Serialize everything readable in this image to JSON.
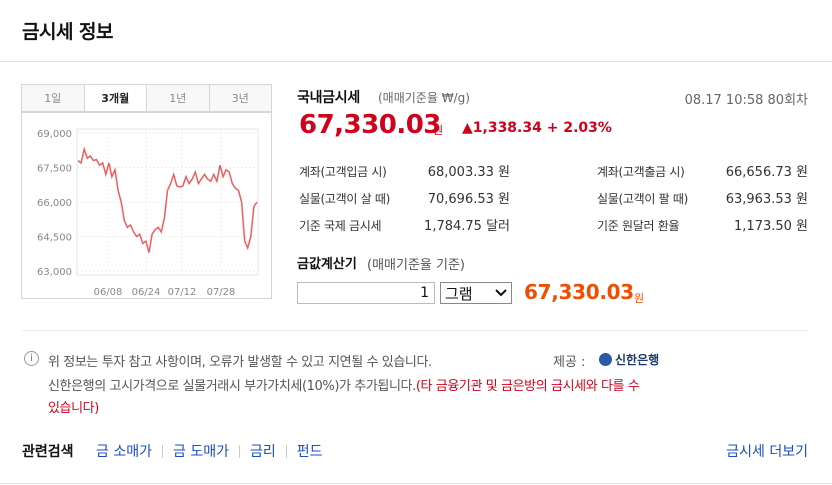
{
  "header": {
    "title": "금시세 정보"
  },
  "tabs": [
    "1일",
    "3개월",
    "1년",
    "3년"
  ],
  "active_tab": "3개월",
  "current": {
    "name": "국내금시세",
    "basis": "(매매기준율 ₩/g)",
    "date": "08.17 10:58 80회차",
    "price": "67,330.03",
    "price_unit": "원",
    "change": "▲1,338.34 + 2.03%"
  },
  "rates": {
    "left": [
      {
        "label": "계좌(고객입금 시)",
        "value": "68,003.33 원"
      },
      {
        "label": "실물(고객이 살 때)",
        "value": "70,696.53 원"
      },
      {
        "label": "기준 국제 금시세",
        "value": "1,784.75 달러"
      }
    ],
    "right": [
      {
        "label": "계좌(고객출금 시)",
        "value": "66,656.73 원"
      },
      {
        "label": "실물(고객이 팔 때)",
        "value": "63,963.53 원"
      },
      {
        "label": "기준 원달러 환율",
        "value": "1,173.50 원"
      }
    ]
  },
  "calculator": {
    "title": "금값계산기",
    "basis": "(매매기준율 기준)",
    "quantity": "1",
    "unit_selected": "그램",
    "result": "67,330.03",
    "result_unit": "원"
  },
  "notice": {
    "line1": "위 정보는 투자 참고 사항이며, 오류가 발생할 수 있고 지연될 수 있습니다.",
    "source_label": "제공 :",
    "source": "신한은행",
    "line2": "신한은행의 고시가격으로 실물거래시 부가가치세(10%)가 추가됩니다.",
    "line2_red": "(타 금융기관 및 금은방의 금시세와 다를 수",
    "line3_red": "있습니다)"
  },
  "related": {
    "label": "관련검색",
    "links": [
      "금 소매가",
      "금 도매가",
      "금리",
      "펀드"
    ],
    "more": "금시세 더보기"
  },
  "colors": {
    "up": "#d0021b",
    "result": "#f04e00",
    "link": "#1a4dbf",
    "chart_line": "#f25c5c"
  },
  "chart_data": {
    "type": "line",
    "x_ticks": [
      "06/08",
      "06/24",
      "07/12",
      "07/28"
    ],
    "y_ticks": [
      "69,000",
      "67,500",
      "66,000",
      "64,500",
      "63,000"
    ],
    "ylim": [
      63000,
      69000
    ],
    "series": [
      {
        "values": [
          67800,
          67700,
          68300,
          67900,
          68000,
          67800,
          67850,
          67600,
          67700,
          67200,
          67700,
          67100,
          67400,
          66500,
          66000,
          65200,
          64900,
          65000,
          64700,
          64500,
          64600,
          64200,
          64300,
          63800,
          64600,
          64800,
          64900,
          64700,
          65300,
          66500,
          66800,
          67200,
          66700,
          66650,
          66700,
          67100,
          66800,
          67000,
          67300,
          66800,
          67000,
          67200,
          67000,
          66900,
          67200,
          66900,
          67600,
          67100,
          67400,
          67300,
          66800,
          66600,
          66500,
          66000,
          64300,
          64000,
          64500,
          65800,
          66000
        ]
      }
    ]
  }
}
